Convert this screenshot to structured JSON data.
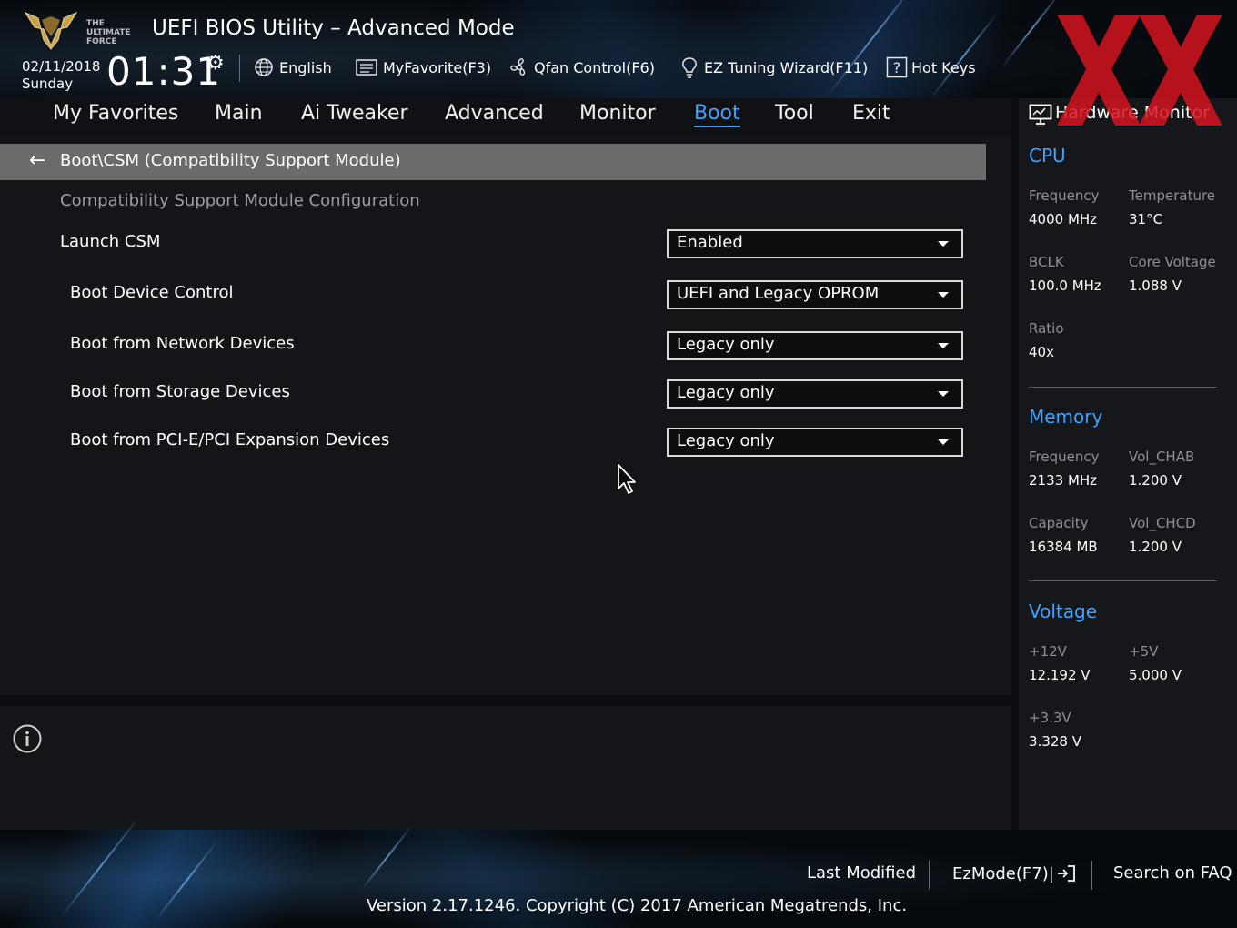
{
  "header": {
    "title": "UEFI BIOS Utility – Advanced Mode",
    "date": "02/11/2018",
    "day": "Sunday",
    "time": "01:31",
    "logo_text": "THE ULTIMATE FORCE",
    "buttons": {
      "language": "English",
      "myfavorite": "MyFavorite(F3)",
      "qfan": "Qfan Control(F6)",
      "ez_tuning": "EZ Tuning Wizard(F11)",
      "hotkeys": "Hot Keys"
    }
  },
  "menu": {
    "tabs": [
      "My Favorites",
      "Main",
      "Ai Tweaker",
      "Advanced",
      "Monitor",
      "Boot",
      "Tool",
      "Exit"
    ],
    "active": "Boot"
  },
  "main": {
    "breadcrumb": "Boot\\CSM (Compatibility Support Module)",
    "section_heading": "Compatibility Support Module Configuration",
    "settings": [
      {
        "label": "Launch CSM",
        "value": "Enabled"
      },
      {
        "label": "Boot Device Control",
        "value": "UEFI and Legacy OPROM"
      },
      {
        "label": "Boot from Network Devices",
        "value": "Legacy only"
      },
      {
        "label": "Boot from Storage Devices",
        "value": "Legacy only"
      },
      {
        "label": "Boot from PCI-E/PCI Expansion Devices",
        "value": "Legacy only"
      }
    ]
  },
  "hardware_monitor": {
    "title": "Hardware Monitor",
    "cpu": {
      "heading": "CPU",
      "frequency_label": "Frequency",
      "frequency": "4000 MHz",
      "temperature_label": "Temperature",
      "temperature": "31°C",
      "bclk_label": "BCLK",
      "bclk": "100.0 MHz",
      "core_voltage_label": "Core Voltage",
      "core_voltage": "1.088 V",
      "ratio_label": "Ratio",
      "ratio": "40x"
    },
    "memory": {
      "heading": "Memory",
      "frequency_label": "Frequency",
      "frequency": "2133 MHz",
      "vol_chab_label": "Vol_CHAB",
      "vol_chab": "1.200 V",
      "capacity_label": "Capacity",
      "capacity": "16384 MB",
      "vol_chcd_label": "Vol_CHCD",
      "vol_chcd": "1.200 V"
    },
    "voltage": {
      "heading": "Voltage",
      "v12_label": "+12V",
      "v12": "12.192 V",
      "v5_label": "+5V",
      "v5": "5.000 V",
      "v33_label": "+3.3V",
      "v33": "3.328 V"
    }
  },
  "footer": {
    "last_modified": "Last Modified",
    "ezmode": "EzMode(F7)|",
    "search_faq": "Search on FAQ",
    "version": "Version 2.17.1246. Copyright (C) 2017 American Megatrends, Inc."
  },
  "colors": {
    "accent": "#3fa2ff",
    "breadcrumb_bg": "#6a6b6d",
    "watermark_red": "#d4141e"
  },
  "icons": {
    "language": "globe-icon",
    "myfavorite": "list-icon",
    "qfan": "fan-icon",
    "ez_tuning": "lightbulb-icon",
    "hotkeys": "question-box-icon",
    "settings": "gear-icon",
    "hardware_monitor": "monitor-icon",
    "info": "info-icon",
    "back": "back-arrow-icon",
    "ezmode": "exit-arrow-icon"
  }
}
